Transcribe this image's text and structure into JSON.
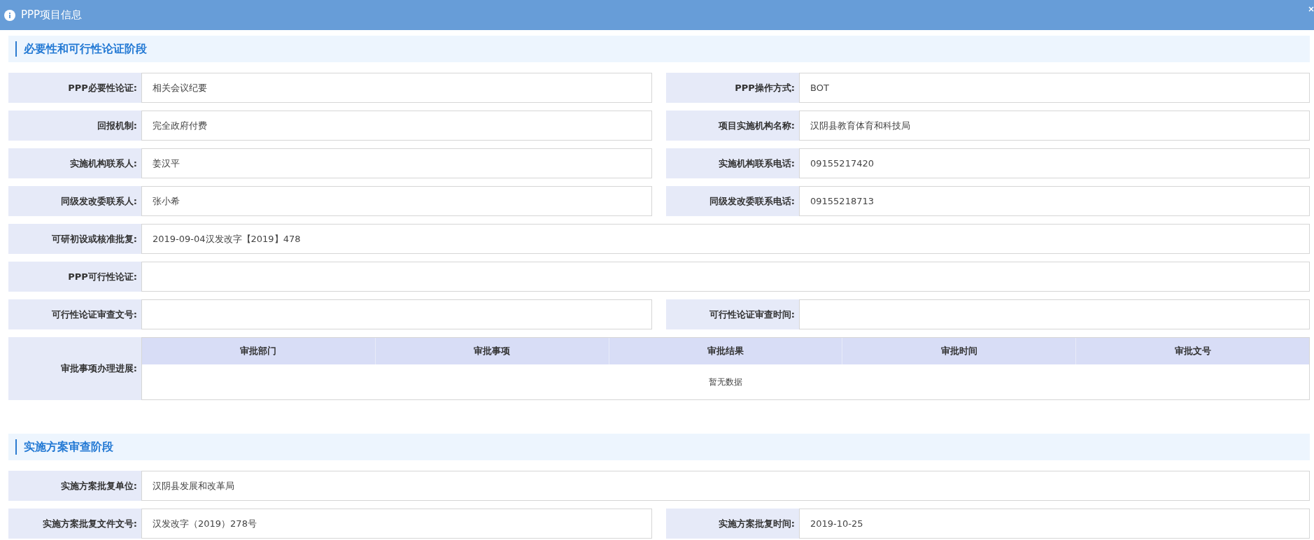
{
  "window": {
    "title": "PPP项目信息"
  },
  "sections": [
    {
      "title": "必要性和可行性论证阶段",
      "rows": [
        {
          "kind": "fields",
          "fields": [
            {
              "label": "PPP必要性论证:",
              "value": "相关会议纪要"
            },
            {
              "label": "PPP操作方式:",
              "value": "BOT"
            }
          ]
        },
        {
          "kind": "fields",
          "fields": [
            {
              "label": "回报机制:",
              "value": "完全政府付费"
            },
            {
              "label": "项目实施机构名称:",
              "value": "汉阴县教育体育和科技局"
            }
          ]
        },
        {
          "kind": "fields",
          "fields": [
            {
              "label": "实施机构联系人:",
              "value": "姜汉平"
            },
            {
              "label": "实施机构联系电话:",
              "value": "09155217420"
            }
          ]
        },
        {
          "kind": "fields",
          "fields": [
            {
              "label": "同级发改委联系人:",
              "value": "张小希"
            },
            {
              "label": "同级发改委联系电话:",
              "value": "09155218713"
            }
          ]
        },
        {
          "kind": "fields",
          "fields": [
            {
              "label": "可研初设或核准批复:",
              "value": "2019-09-04汉发改字【2019】478"
            }
          ]
        },
        {
          "kind": "fields",
          "fields": [
            {
              "label": "PPP可行性论证:"
            }
          ]
        },
        {
          "kind": "fields",
          "fields": [
            {
              "label": "可行性论证审查文号:"
            },
            {
              "label": "可行性论证审查时间:"
            }
          ]
        },
        {
          "kind": "table",
          "label": "审批事项办理进展:",
          "columns": [
            "审批部门",
            "审批事项",
            "审批结果",
            "审批时间",
            "审批文号"
          ],
          "empty_text": "暂无数据"
        }
      ]
    },
    {
      "title": "实施方案审查阶段",
      "rows": [
        {
          "kind": "fields",
          "fields": [
            {
              "label": "实施方案批复单位:",
              "value": "汉阴县发展和改革局"
            }
          ]
        },
        {
          "kind": "fields",
          "fields": [
            {
              "label": "实施方案批复文件文号:",
              "value": "汉发改字（2019）278号"
            },
            {
              "label": "实施方案批复时间:",
              "value": "2019-10-25"
            }
          ]
        }
      ]
    }
  ]
}
